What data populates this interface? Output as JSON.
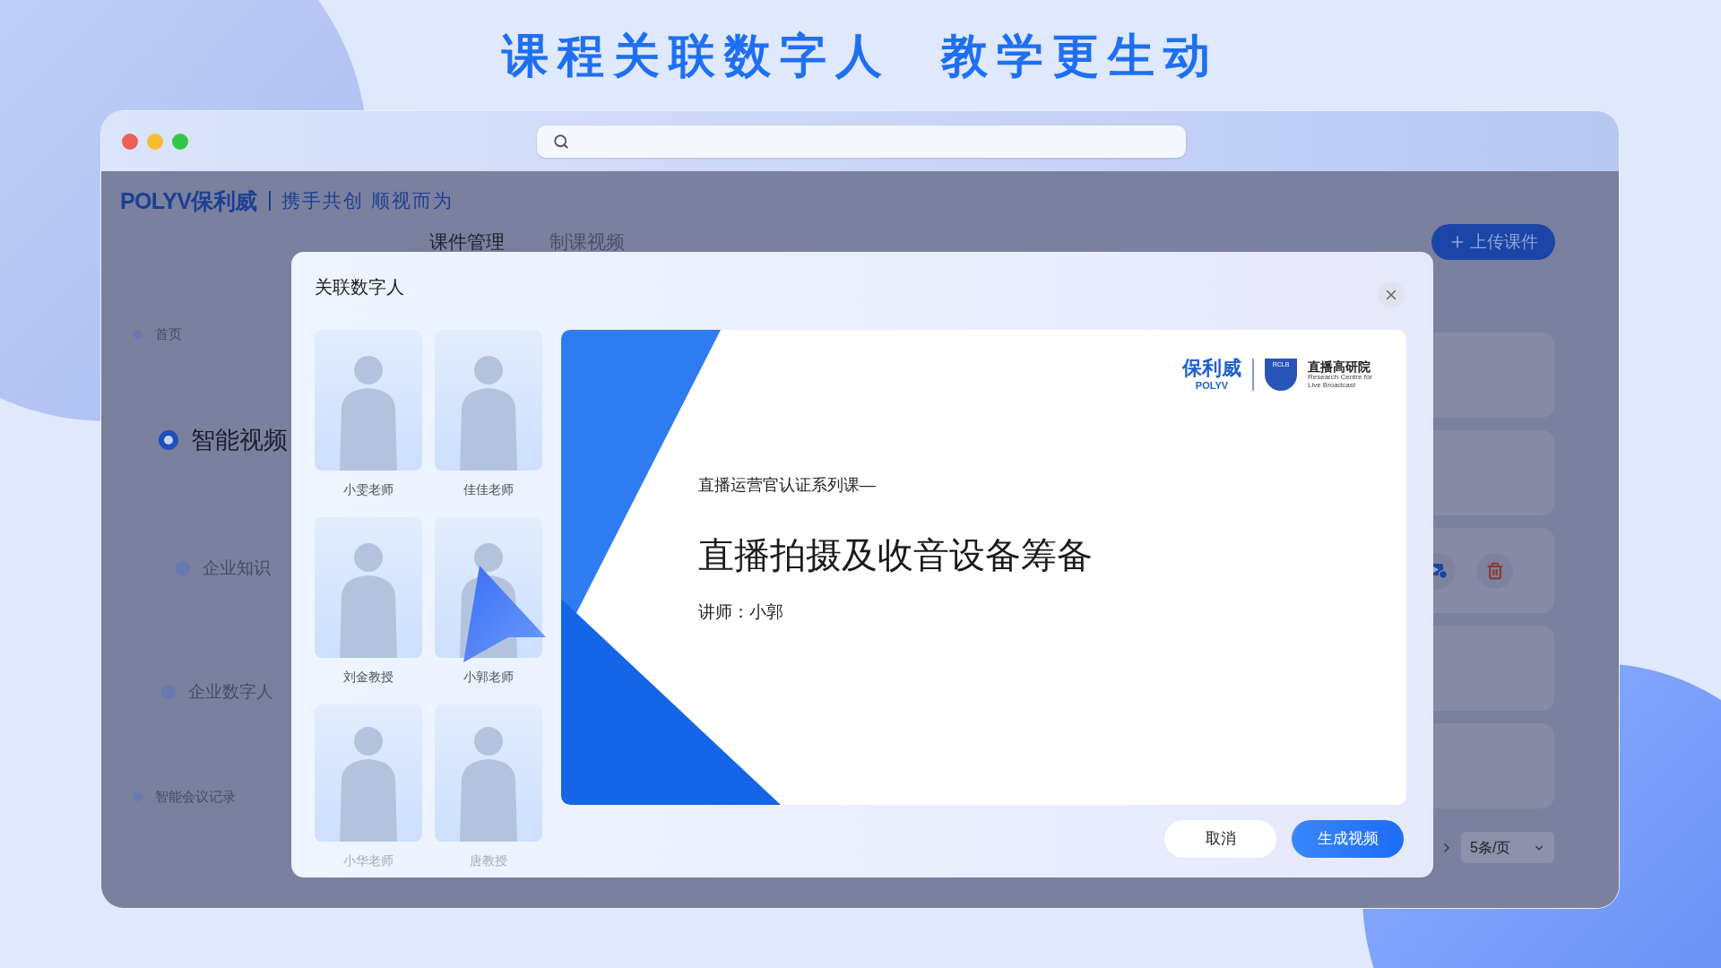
{
  "headline": "课程关联数字人  教学更生动",
  "window": {
    "traffic_lights": [
      {
        "color": "#f05f57"
      },
      {
        "color": "#f7bd2e"
      },
      {
        "color": "#33c748"
      }
    ]
  },
  "app": {
    "brand": "POLYV保利威",
    "slogan": "携手共创 顺视而为",
    "tabs": [
      {
        "label": "课件管理",
        "selected": true
      },
      {
        "label": "制课视频",
        "selected": false
      }
    ],
    "upload_button": "上传课件",
    "sidebar": [
      {
        "label": "首页",
        "selected": false
      },
      {
        "label": "智能视频",
        "selected": true
      },
      {
        "label": "企业知识",
        "selected": false
      },
      {
        "label": "企业数字人",
        "selected": false
      },
      {
        "label": "智能会议记录",
        "selected": false
      }
    ],
    "page_size": "5条/页"
  },
  "dialog": {
    "title": "关联数字人",
    "avatars": [
      {
        "name": "小雯老师"
      },
      {
        "name": "佳佳老师"
      },
      {
        "name": "刘金教授"
      },
      {
        "name": "小郭老师"
      },
      {
        "name": "小华老师"
      },
      {
        "name": "唐教授"
      }
    ],
    "preview": {
      "logo": {
        "brand_cn": "保利威",
        "brand_en": "POLYV",
        "badge": "RCLB",
        "institute_cn": "直播高研院",
        "institute_en": [
          "Research Centre for",
          "Live Broadcast"
        ]
      },
      "series": "直播运营官认证系列课—",
      "title": "直播拍摄及收音设备筹备",
      "lecturer": "讲师：小郭"
    },
    "cancel_button": "取消",
    "confirm_button": "生成视频"
  }
}
